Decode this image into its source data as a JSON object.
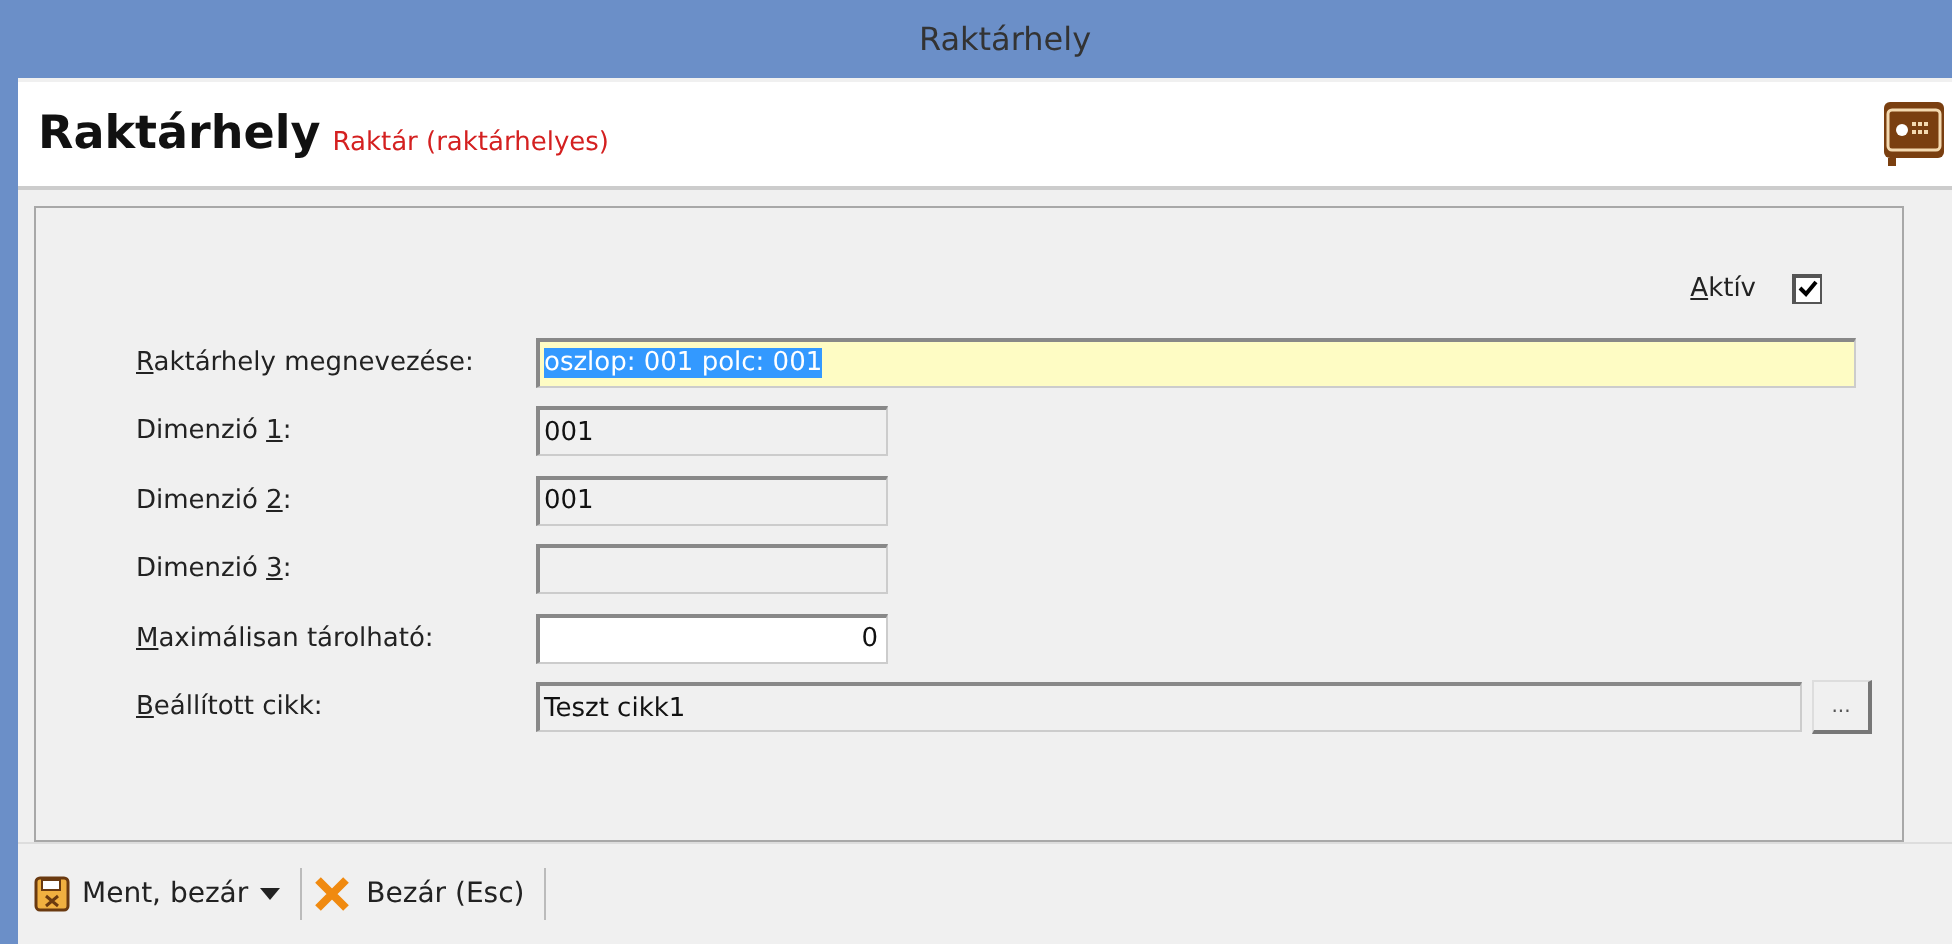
{
  "window": {
    "title": "Raktárhely"
  },
  "header": {
    "title": "Raktárhely",
    "subtitle": "Raktár (raktárhelyes)"
  },
  "active": {
    "label": {
      "key": "A",
      "post": "ktív"
    },
    "checked": true
  },
  "fields": [
    {
      "kind": "highlight",
      "label": {
        "key": "R",
        "post": "aktárhely megnevezése:"
      },
      "value": "oszlop: 001 polc: 001"
    },
    {
      "kind": "readonly",
      "label": {
        "pre": "Dimenzió ",
        "key": "1",
        "post": ":"
      },
      "value": "001"
    },
    {
      "kind": "readonly",
      "label": {
        "pre": "Dimenzió ",
        "key": "2",
        "post": ":"
      },
      "value": "001"
    },
    {
      "kind": "readonly",
      "label": {
        "pre": "Dimenzió ",
        "key": "3",
        "post": ":"
      }
    },
    {
      "kind": "number",
      "label": {
        "key": "M",
        "post": "aximálisan tárolható:"
      },
      "value": "0"
    },
    {
      "kind": "lookup",
      "label": {
        "key": "B",
        "post": "eállított cikk:"
      },
      "value": "Teszt cikk1",
      "button": "..."
    }
  ],
  "toolbar": [
    {
      "kind": "save",
      "label": "Ment, bezár",
      "dropdown": true
    },
    {
      "kind": "close",
      "label": "Bezár (Esc)",
      "dropdown": false
    }
  ]
}
